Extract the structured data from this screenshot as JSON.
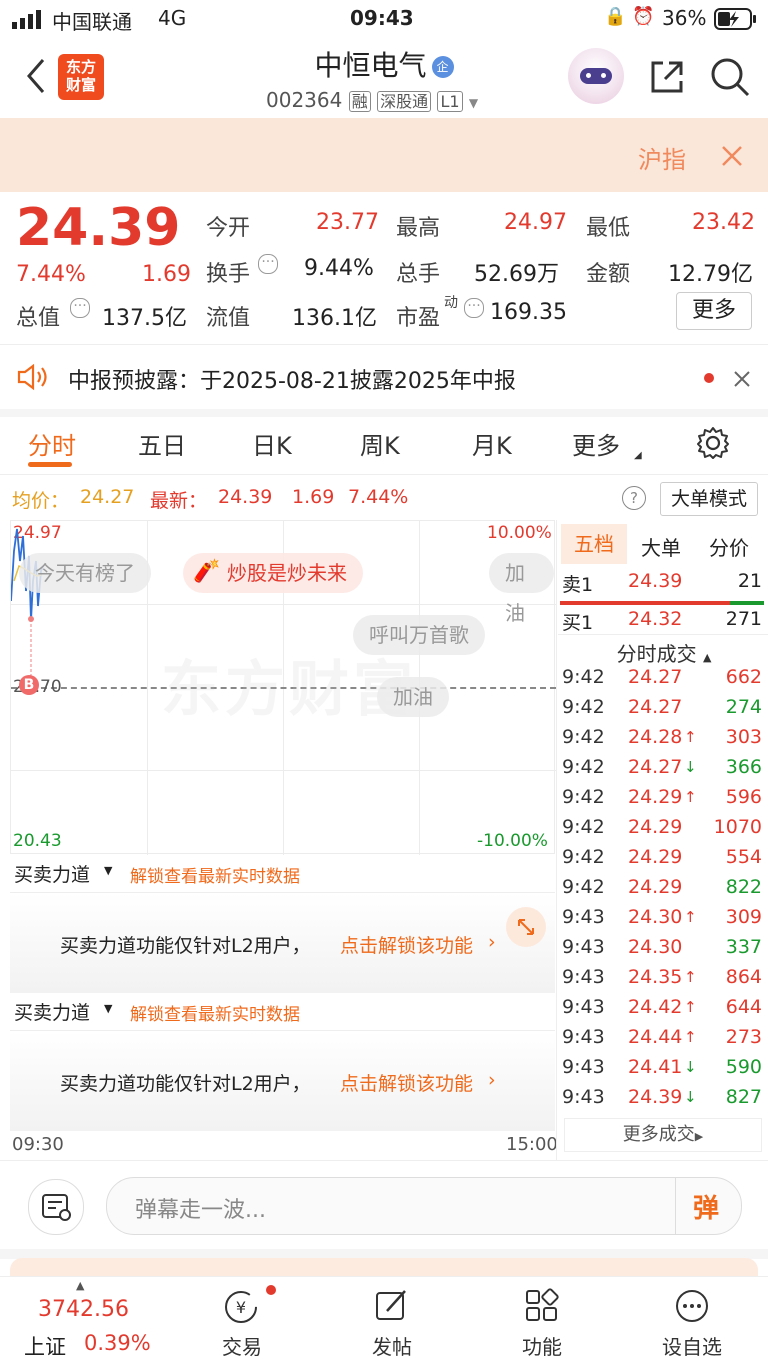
{
  "status_bar": {
    "carrier": "中国联通",
    "network": "4G",
    "time": "09:43",
    "battery": "36%"
  },
  "header": {
    "title": "中恒电气",
    "badge": "企",
    "code": "002364",
    "tags": [
      "融",
      "深股通",
      "L1"
    ],
    "brand_logo": "东方\n财富"
  },
  "banner": {
    "text": "沪指"
  },
  "quote": {
    "price": "24.39",
    "change_pct": "7.44%",
    "change": "1.69",
    "open_label": "今开",
    "open": "23.77",
    "high_label": "最高",
    "high": "24.97",
    "low_label": "最低",
    "low": "23.42",
    "turnover_label": "换手",
    "turnover": "9.44%",
    "volume_label": "总手",
    "volume": "52.69万",
    "amount_label": "金额",
    "amount": "12.79亿",
    "mktcap_label": "总值",
    "mktcap": "137.5亿",
    "float_label": "流值",
    "float": "136.1亿",
    "pe_label": "市盈",
    "pe_sup": "动",
    "pe": "169.35",
    "more_label": "更多"
  },
  "notice": {
    "text": "中报预披露：于2025-08-21披露2025年中报"
  },
  "tabs": [
    {
      "label": "分时"
    },
    {
      "label": "五日"
    },
    {
      "label": "日K"
    },
    {
      "label": "周K"
    },
    {
      "label": "月K"
    },
    {
      "label": "更多"
    }
  ],
  "chart_header": {
    "avg_label": "均价：",
    "avg": "24.27",
    "latest_label": "最新：",
    "latest": "24.39",
    "chg": "1.69",
    "pct": "7.44%",
    "mode_label": "大单模式"
  },
  "chart": {
    "y_top": "24.97",
    "y_bottom": "20.43",
    "y_mid": "22.70",
    "pct_top": "10.00%",
    "pct_bottom": "-10.00%",
    "watermark": "东方财富",
    "time_start": "09:30",
    "time_end": "15:00",
    "danmaku": [
      "今天有榜了",
      "炒股是炒未来",
      "加油",
      "呼叫万首歌",
      "加油"
    ],
    "buy_marker": "B"
  },
  "power_panels": [
    {
      "title": "买卖力道",
      "link": "解锁查看最新实时数据",
      "msg": "买卖力道功能仅针对L2用户，",
      "action": "点击解锁该功能"
    },
    {
      "title": "买卖力道",
      "link": "解锁查看最新实时数据",
      "msg": "买卖力道功能仅针对L2用户，",
      "action": "点击解锁该功能"
    }
  ],
  "right_panel": {
    "tabs": [
      "五档",
      "大单",
      "分价"
    ],
    "sell1": {
      "label": "卖1",
      "price": "24.39",
      "vol": "21"
    },
    "buy1": {
      "label": "买1",
      "price": "24.32",
      "vol": "271"
    },
    "trades_title": "分时成交",
    "trades": [
      {
        "t": "9:42",
        "p": "24.27",
        "a": "",
        "v": "662",
        "vc": "red"
      },
      {
        "t": "9:42",
        "p": "24.27",
        "a": "",
        "v": "274",
        "vc": "green"
      },
      {
        "t": "9:42",
        "p": "24.28",
        "a": "↑",
        "v": "303",
        "vc": "red"
      },
      {
        "t": "9:42",
        "p": "24.27",
        "a": "↓",
        "v": "366",
        "vc": "green"
      },
      {
        "t": "9:42",
        "p": "24.29",
        "a": "↑",
        "v": "596",
        "vc": "red"
      },
      {
        "t": "9:42",
        "p": "24.29",
        "a": "",
        "v": "1070",
        "vc": "red"
      },
      {
        "t": "9:42",
        "p": "24.29",
        "a": "",
        "v": "554",
        "vc": "red"
      },
      {
        "t": "9:42",
        "p": "24.29",
        "a": "",
        "v": "822",
        "vc": "green"
      },
      {
        "t": "9:43",
        "p": "24.30",
        "a": "↑",
        "v": "309",
        "vc": "red"
      },
      {
        "t": "9:43",
        "p": "24.30",
        "a": "",
        "v": "337",
        "vc": "green"
      },
      {
        "t": "9:43",
        "p": "24.35",
        "a": "↑",
        "v": "864",
        "vc": "red"
      },
      {
        "t": "9:43",
        "p": "24.42",
        "a": "↑",
        "v": "644",
        "vc": "red"
      },
      {
        "t": "9:43",
        "p": "24.44",
        "a": "↑",
        "v": "273",
        "vc": "red"
      },
      {
        "t": "9:43",
        "p": "24.41",
        "a": "↓",
        "v": "590",
        "vc": "green"
      },
      {
        "t": "9:43",
        "p": "24.39",
        "a": "↓",
        "v": "827",
        "vc": "green"
      }
    ],
    "more_trades": "更多成交"
  },
  "danmaku_bar": {
    "placeholder": "弹幕走一波...",
    "send_label": "弹"
  },
  "bottom_nav": {
    "index_value": "3742.56",
    "index_name": "上证",
    "index_pct": "0.39%",
    "items": [
      {
        "label": "交易"
      },
      {
        "label": "发帖"
      },
      {
        "label": "功能"
      },
      {
        "label": "设自选"
      }
    ]
  },
  "colors": {
    "up": "#e33a2e",
    "down": "#1a9a2e",
    "accent": "#f06a1c"
  }
}
